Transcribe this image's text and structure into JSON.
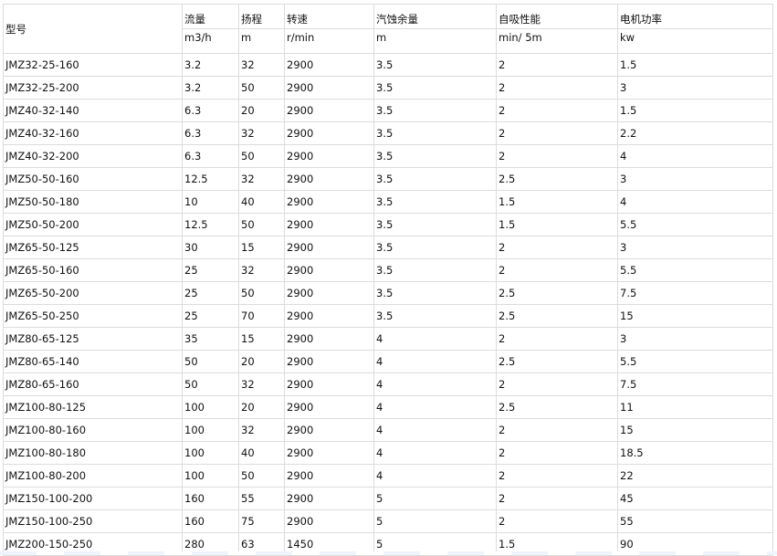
{
  "table": {
    "headers": {
      "model": "型号",
      "names": [
        "流量",
        "扬程",
        "转速",
        "汽蚀余量",
        "自吸性能",
        "电机功率"
      ],
      "units": [
        "m3/h",
        "m",
        "r/min",
        "m",
        "min/ 5m",
        "kw"
      ]
    },
    "rows": [
      [
        "JMZ32-25-160",
        "3.2",
        "32",
        "2900",
        "3.5",
        "2",
        "1.5"
      ],
      [
        "JMZ32-25-200",
        "3.2",
        "50",
        "2900",
        "3.5",
        "2",
        "3"
      ],
      [
        "JMZ40-32-140",
        "6.3",
        "20",
        "2900",
        "3.5",
        "2",
        "1.5"
      ],
      [
        "JMZ40-32-160",
        "6.3",
        "32",
        "2900",
        "3.5",
        "2",
        "2.2"
      ],
      [
        "JMZ40-32-200",
        "6.3",
        "50",
        "2900",
        "3.5",
        "2",
        "4"
      ],
      [
        "JMZ50-50-160",
        "12.5",
        "32",
        "2900",
        "3.5",
        "2.5",
        "3"
      ],
      [
        "JMZ50-50-180",
        "10",
        "40",
        "2900",
        "3.5",
        "1.5",
        "4"
      ],
      [
        "JMZ50-50-200",
        "12.5",
        "50",
        "2900",
        "3.5",
        "1.5",
        "5.5"
      ],
      [
        "JMZ65-50-125",
        "30",
        "15",
        "2900",
        "3.5",
        "2",
        "3"
      ],
      [
        "JMZ65-50-160",
        "25",
        "32",
        "2900",
        "3.5",
        "2",
        "5.5"
      ],
      [
        "JMZ65-50-200",
        "25",
        "50",
        "2900",
        "3.5",
        "2.5",
        "7.5"
      ],
      [
        "JMZ65-50-250",
        "25",
        "70",
        "2900",
        "3.5",
        "2.5",
        "15"
      ],
      [
        "JMZ80-65-125",
        "35",
        "15",
        "2900",
        "4",
        "2",
        "3"
      ],
      [
        "JMZ80-65-140",
        "50",
        "20",
        "2900",
        "4",
        "2.5",
        "5.5"
      ],
      [
        "JMZ80-65-160",
        "50",
        "32",
        "2900",
        "4",
        "2",
        "7.5"
      ],
      [
        "JMZ100-80-125",
        "100",
        "20",
        "2900",
        "4",
        "2.5",
        "11"
      ],
      [
        "JMZ100-80-160",
        "100",
        "32",
        "2900",
        "4",
        "2",
        "15"
      ],
      [
        "JMZ100-80-180",
        "100",
        "40",
        "2900",
        "4",
        "2",
        "18.5"
      ],
      [
        "JMZ100-80-200",
        "100",
        "50",
        "2900",
        "4",
        "2",
        "22"
      ],
      [
        "JMZ150-100-200",
        "160",
        "55",
        "2900",
        "5",
        "2",
        "45"
      ],
      [
        "JMZ150-100-250",
        "160",
        "75",
        "2900",
        "5",
        "2",
        "55"
      ],
      [
        "JMZ200-150-250",
        "280",
        "63",
        "1450",
        "5",
        "1.5",
        "90"
      ]
    ]
  }
}
